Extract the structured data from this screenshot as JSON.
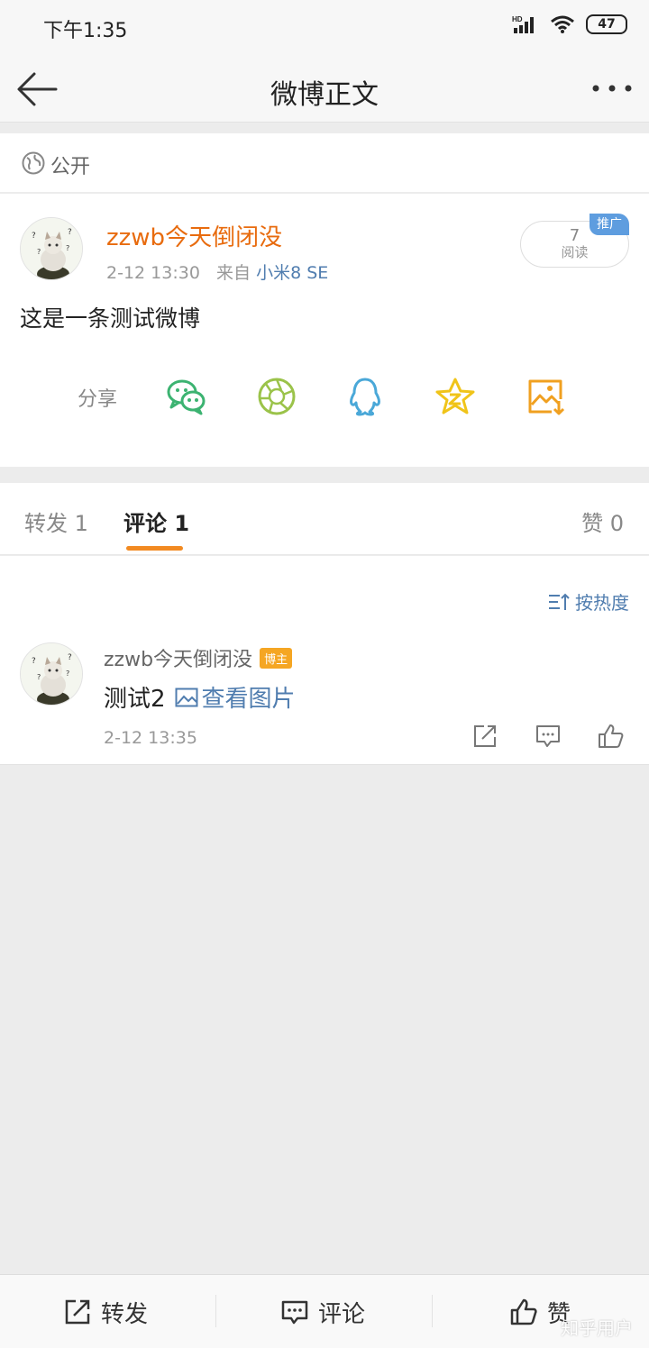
{
  "status_bar": {
    "time": "下午1:35",
    "battery": "47",
    "hd": "HD"
  },
  "nav": {
    "title": "微博正文",
    "back_icon": "arrow-left-icon",
    "more_icon": "more-dots-icon"
  },
  "visibility": {
    "label": "公开",
    "icon": "globe-icon"
  },
  "post": {
    "user": "zzwb今天倒闭没",
    "time": "2-12 13:30",
    "from": "来自",
    "device": "小米8 SE",
    "read_count": "7",
    "read_label": "阅读",
    "promo_badge": "推广",
    "text": "这是一条测试微博"
  },
  "share": {
    "label": "分享",
    "targets": [
      {
        "icon": "wechat-icon",
        "color": "#3cb371"
      },
      {
        "icon": "moments-icon",
        "color": "#9bc34a"
      },
      {
        "icon": "qq-icon",
        "color": "#4aa8d8"
      },
      {
        "icon": "qzone-star-icon",
        "color": "#f0c419"
      },
      {
        "icon": "save-image-icon",
        "color": "#f0a020"
      }
    ]
  },
  "tabs": [
    {
      "label": "转发 1",
      "active": false
    },
    {
      "label": "评论 1",
      "active": true
    },
    {
      "label": "赞 0",
      "active": false
    }
  ],
  "comments": {
    "sort_label": "按热度",
    "items": [
      {
        "user": "zzwb今天倒闭没",
        "badge": "博主",
        "text": "测试2",
        "link": "查看图片",
        "time": "2-12 13:35"
      }
    ]
  },
  "bottom_bar": {
    "repost": "转发",
    "comment": "评论",
    "like": "赞"
  },
  "watermark": "知乎用户",
  "colors": {
    "accent": "#f28a21",
    "username": "#e86b0e",
    "link": "#507daf"
  }
}
